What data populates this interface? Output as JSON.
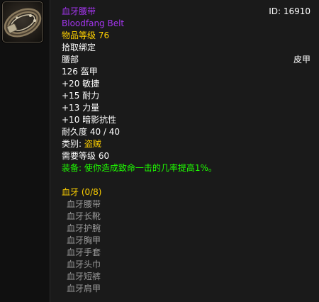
{
  "item": {
    "name": "血牙腰带",
    "name_en": "Bloodfang Belt",
    "id_label": "ID: 16910",
    "item_level": "物品等级 76",
    "binding": "拾取绑定",
    "slot": "腰部",
    "armor_type": "皮甲",
    "armor": "126 盔甲",
    "stats": [
      "+20 敏捷",
      "+15 耐力",
      "+13 力量",
      "+10 暗影抗性"
    ],
    "durability": "耐久度 40 / 40",
    "class_label": "类别: ",
    "class_value": "盗贼",
    "required_level": "需要等级 60",
    "equip_effect": "装备: 使你造成致命一击的几率提高1%。",
    "icon": "belt-icon"
  },
  "set": {
    "title": "血牙 (0/8)",
    "pieces": [
      "血牙腰带",
      "血牙长靴",
      "血牙护腕",
      "血牙胸甲",
      "血牙手套",
      "血牙头巾",
      "血牙短裤",
      "血牙肩甲"
    ]
  },
  "colors": {
    "epic": "#a335ee",
    "gold": "#ffd100",
    "green": "#1eff00",
    "grey": "#9a9a9a",
    "background": "#1a1a1a"
  }
}
